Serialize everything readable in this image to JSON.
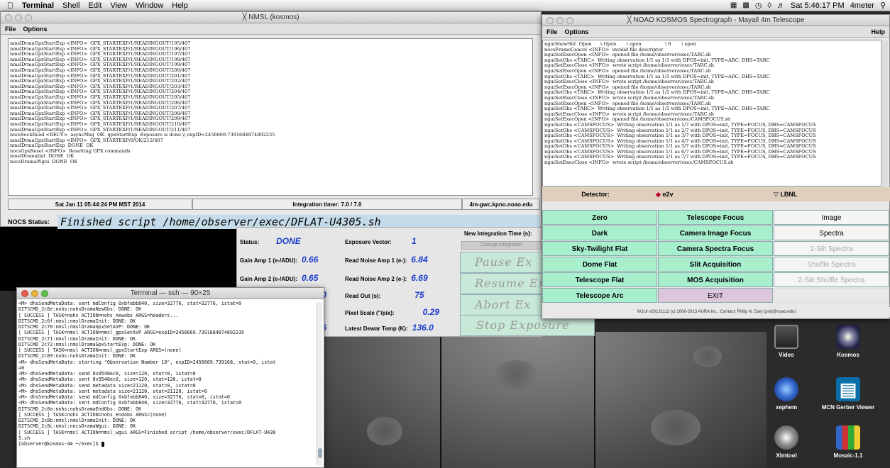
{
  "menubar": {
    "apple": "",
    "app": "Terminal",
    "items": [
      "Shell",
      "Edit",
      "View",
      "Window",
      "Help"
    ],
    "clock": "Sat 5:46:17 PM",
    "user": "4meter"
  },
  "nmsl": {
    "title": "NMSL (kosmos)",
    "menu": [
      "File",
      "Options"
    ],
    "log": "nmslDrmaGpxStartExp <INFO>  GPX_STARTEXP/1/READINGOUT/195/407\nnmslDrmaGpxStartExp <INFO>  GPX_STARTEXP/1/READINGOUT/196/407\nnmslDrmaGpxStartExp <INFO>  GPX_STARTEXP/1/READINGOUT/197/407\nnmslDrmaGpxStartExp <INFO>  GPX_STARTEXP/1/READINGOUT/198/407\nnmslDrmaGpxStartExp <INFO>  GPX_STARTEXP/1/READINGOUT/199/407\nnmslDrmaGpxStartExp <INFO>  GPX_STARTEXP/1/READINGOUT/200/407\nnmslDrmaGpxStartExp <INFO>  GPX_STARTEXP/1/READINGOUT/201/407\nnmslDrmaGpxStartExp <INFO>  GPX_STARTEXP/1/READINGOUT/202/407\nnmslDrmaGpxStartExp <INFO>  GPX_STARTEXP/1/READINGOUT/203/407\nnmslDrmaGpxStartExp <INFO>  GPX_STARTEXP/1/READINGOUT/204/407\nnmslDrmaGpxStartExp <INFO>  GPX_STARTEXP/1/READINGOUT/205/407\nnmslDrmaGpxStartExp <INFO>  GPX_STARTEXP/1/READINGOUT/206/407\nnmslDrmaGpxStartExp <INFO>  GPX_STARTEXP/1/READINGOUT/207/407\nnmslDrmaGpxStartExp <INFO>  GPX_STARTEXP/1/READINGOUT/208/407\nnmslDrmaGpxStartExp <INFO>  GPX_STARTEXP/1/READINGOUT/209/407\nnmslDrmaGpxStartExp <INFO>  GPX_STARTEXP/1/READINGOUT/210/407\nnmslDrmaGpxStartExp <INFO>  GPX_STARTEXP/1/READINGOUT/211/407\nnocsSockRead <RECV>  asyncMsg  OK  gpxStartExp  Exposure is done \\\\ expID=2456669.7391684874892235\nnmslDrmaGpxStartExp <INFO>  GPX_STARTEXP/0/OK/212/407\nnmslDrmaGpxStartExp  DONE  OK\nnocsGpxReset <INFO>  Resetting GPX commands\nnmslDramaInit  DONE  OK\nnocsDramaWgui  DONE  OK",
    "status_date": "Sat Jan 11 05:44:24 PM MST 2014",
    "integration_timer": "Integration timer: 7.0 / 7.0",
    "host": "4m-gwc.kpno.noao.edu",
    "nocs_label": "NOCS Status:",
    "nocs_value": "Finished script /home/observer/exec/DFLAT-U4305.sh"
  },
  "exposure": {
    "status_label": "Status:",
    "status_value": "DONE",
    "exposure_vector_label": "Exposure Vector:",
    "exposure_vector_value": "1",
    "new_integration_label": "New Integration Time (s):",
    "change_integration": "Change integration",
    "gain1_label": "Gain Amp 1 (e-/ADU):",
    "gain1_value": "0.66",
    "readnoise1_label": "Read Noise Amp 1 (e-):",
    "readnoise1_value": "6.84",
    "gain2_label": "Gain Amp 2 (e-/ADU):",
    "gain2_value": "0.65",
    "readnoise2_label": "Read Noise Amp 2 (e-):",
    "readnoise2_value": "6.69",
    "partial_value_1": "100",
    "readout_label": "Read Out (s):",
    "readout_value": "75",
    "pixel_scale_label": "Pixel Scale (\"/pix):",
    "pixel_scale_value": "0.29",
    "partial_value_2": "206",
    "dewar_label": "Latest Dewar Temp (K):",
    "dewar_value": "136.0",
    "pause": "Pause Ex",
    "resume": "Resume Ex",
    "abort": "Abort Ex",
    "stop": "Stop Exposure"
  },
  "kosmos": {
    "title": "NOAO KOSMOS Spectrograph - Mayall 4m Telescope",
    "menu": [
      "File",
      "Options"
    ],
    "help": "Help",
    "log": "nguiShowSlit  Open      \\ Open       \\ open                \\ 6       \\ open\nnocsFrameCancel <INFO>  invalid file descriptor\nnguiSetExecOpen <INFO>  opened file /home/observer/exec/TARC.sh\nnguiSetObs <TARC>  Writing observation 1/1 as 1/1 with DPOS=init, TYPE=ARC, DHS=TARC\nnguiSetExecClose <INFO>  wrote script /home/observer/exec/TARC.sh\nnguiSetExecOpen <INFO>  opened file /home/observer/exec/TARC.sh\nnguiSetObs <TARC>  Writing observation 1/1 as 1/1 with DPOS=init, TYPE=ARC, DHS=TARC\nnguiSetExecClose <INFO>  wrote script /home/observer/exec/TARC.sh\nnguiSetExecOpen <INFO>  opened file /home/observer/exec/TARC.sh\nnguiSetObs <TARC>  Writing observation 1/1 as 1/1 with DPOS=init, TYPE=ARC, DHS=TARC\nnguiSetExecClose <INFO>  wrote script /home/observer/exec/TARC.sh\nnguiSetExecOpen <INFO>  opened file /home/observer/exec/TARC.sh\nnguiSetObs <TARC>  Writing observation 1/1 as 1/1 with DPOS=init, TYPE=ARC, DHS=TARC\nnguiSetExecClose <INFO>  wrote script /home/observer/exec/TARC.sh\nnguiSetExecOpen <INFO>  opened file /home/observer/exec/CAMSFOCUS.sh\nnguiSetObs <CAMSFOCUS>  Writing observation 1/1 as 1/7 with DPOS=init, TYPE=FOCUS, DHS=CAMSFOCUS\nnguiSetObs <CAMSFOCUS>  Writing observation 1/1 as 2/7 with DPOS=init, TYPE=FOCUS, DHS=CAMSFOCUS\nnguiSetObs <CAMSFOCUS>  Writing observation 1/1 as 3/7 with DPOS=init, TYPE=FOCUS, DHS=CAMSFOCUS\nnguiSetObs <CAMSFOCUS>  Writing observation 1/1 as 4/7 with DPOS=init, TYPE=FOCUS, DHS=CAMSFOCUS\nnguiSetObs <CAMSFOCUS>  Writing observation 1/1 as 5/7 with DPOS=init, TYPE=FOCUS, DHS=CAMSFOCUS\nnguiSetObs <CAMSFOCUS>  Writing observation 1/1 as 6/7 with DPOS=init, TYPE=FOCUS, DHS=CAMSFOCUS\nnguiSetObs <CAMSFOCUS>  Writing observation 1/1 as 7/7 with DPOS=init, TYPE=FOCUS, DHS=CAMSFOCUS\nnguiSetExecClose <INFO>  wrote script /home/observer/exec/CAMSFOCUS.sh",
    "detector_label": "Detector:",
    "detector_e2v": "e2v",
    "detector_lbnl": "LBNL",
    "buttons_col1": [
      "Zero",
      "Dark",
      "Sky-Twilight Flat",
      "Dome Flat",
      "Telescope Flat",
      "Telescope Arc"
    ],
    "buttons_col2": [
      "Telescope Focus",
      "Camera Image Focus",
      "Camera Spectra Focus",
      "Slit Acquisition",
      "MOS Acquisition",
      "EXIT"
    ],
    "buttons_col3": [
      "Image",
      "Spectra",
      "2-Slit Spectra",
      "Shuffle Spectra",
      "2-Slit Shuffle Spectra"
    ],
    "footer": "NGUI v20131112 (c) 2006-2013 AURA Inc., Contact: Philip N. Daly (pnd@noao.edu)"
  },
  "terminal": {
    "title": "Terminal — ssh — 90×25",
    "log": "<M> dhsSendMetaData: sent mdConfig 0xbfabb840, size=32776, stat=32776, istat=0\nDITSCMD_2c6e:nohs:nohsDramaNewObs: DONE: OK\n[ SUCCESS ] TASK=nohs ACTION=nohs_newobs ARGS=headers...\nDITSCMD_2c6f:nmsl:nmslDramaInit: DONE: OK\nDITSCMD_2c70:nmsl:nmslDramaGpxSetAVP: DONE: OK\n[ SUCCESS ] TASK=nmsl ACTION=nmsl_gpxSetAVP ARGS=expID=2456669.7391684874892235\nDITSCMD_2c71:nmsl:nmslDramaInit: DONE: OK\nDITSCMD_2c72:nmsl:nmslDramaGpxStartExp: DONE: OK\n[ SUCCESS ] TASK=nmsl ACTION=nmsl_gpxStartExp ARGS=(none)\nDITSCMD_2c89:nohs:nohsDramaInit: DONE: OK\n<M> dhsSendMetaData: starting \"Observation Number 10\", expID=2456669.739168, stat=0, istat\n=0\n<M> dhsSendMetaData: send 0x9548ec0, size=120, stat=0, istat=0\n<M> dhsSendMetaData: sent 0x9548ec0, size=120, stat=120, istat=0\n<M> dhsSendMetaData: send metadata size=21120, stat=0, istat=0\n<M> dhsSendMetaData: sent metadata size=21120, stat=21120, istat=0\n<M> dhsSendMetaData: send mdConfig 0xbfabb840, size=32776, stat=0, istat=0\n<M> dhsSendMetaData: sent mdConfig 0xbfabb840, size=32776, stat=32776, istat=0\nDITSCMD_2c8a:nohs:nohsDramaEndObs: DONE: OK\n[ SUCCESS ] TASK=nohs ACTION=nohs_endobs ARGS=(none)\nDITSCMD_2c8b:nmsl:nmslDramaInit: DONE: OK\nDITSCMD_2c8c:nmsl:nocsDramaWgui: DONE: OK\n[ SUCCESS ] TASK=nmsl ACTION=nmsl_wgui ARGS=Finished script /home/observer/exec/DFLAT-U430\n5.sh\n[observer@kosmos-4m ~/exec]$ "
  },
  "desktop": {
    "icons": [
      "Video",
      "Kosmos",
      "xephem",
      "MCN Gerber Viewer",
      "Ximtool",
      "Mosaic-1.1"
    ]
  }
}
